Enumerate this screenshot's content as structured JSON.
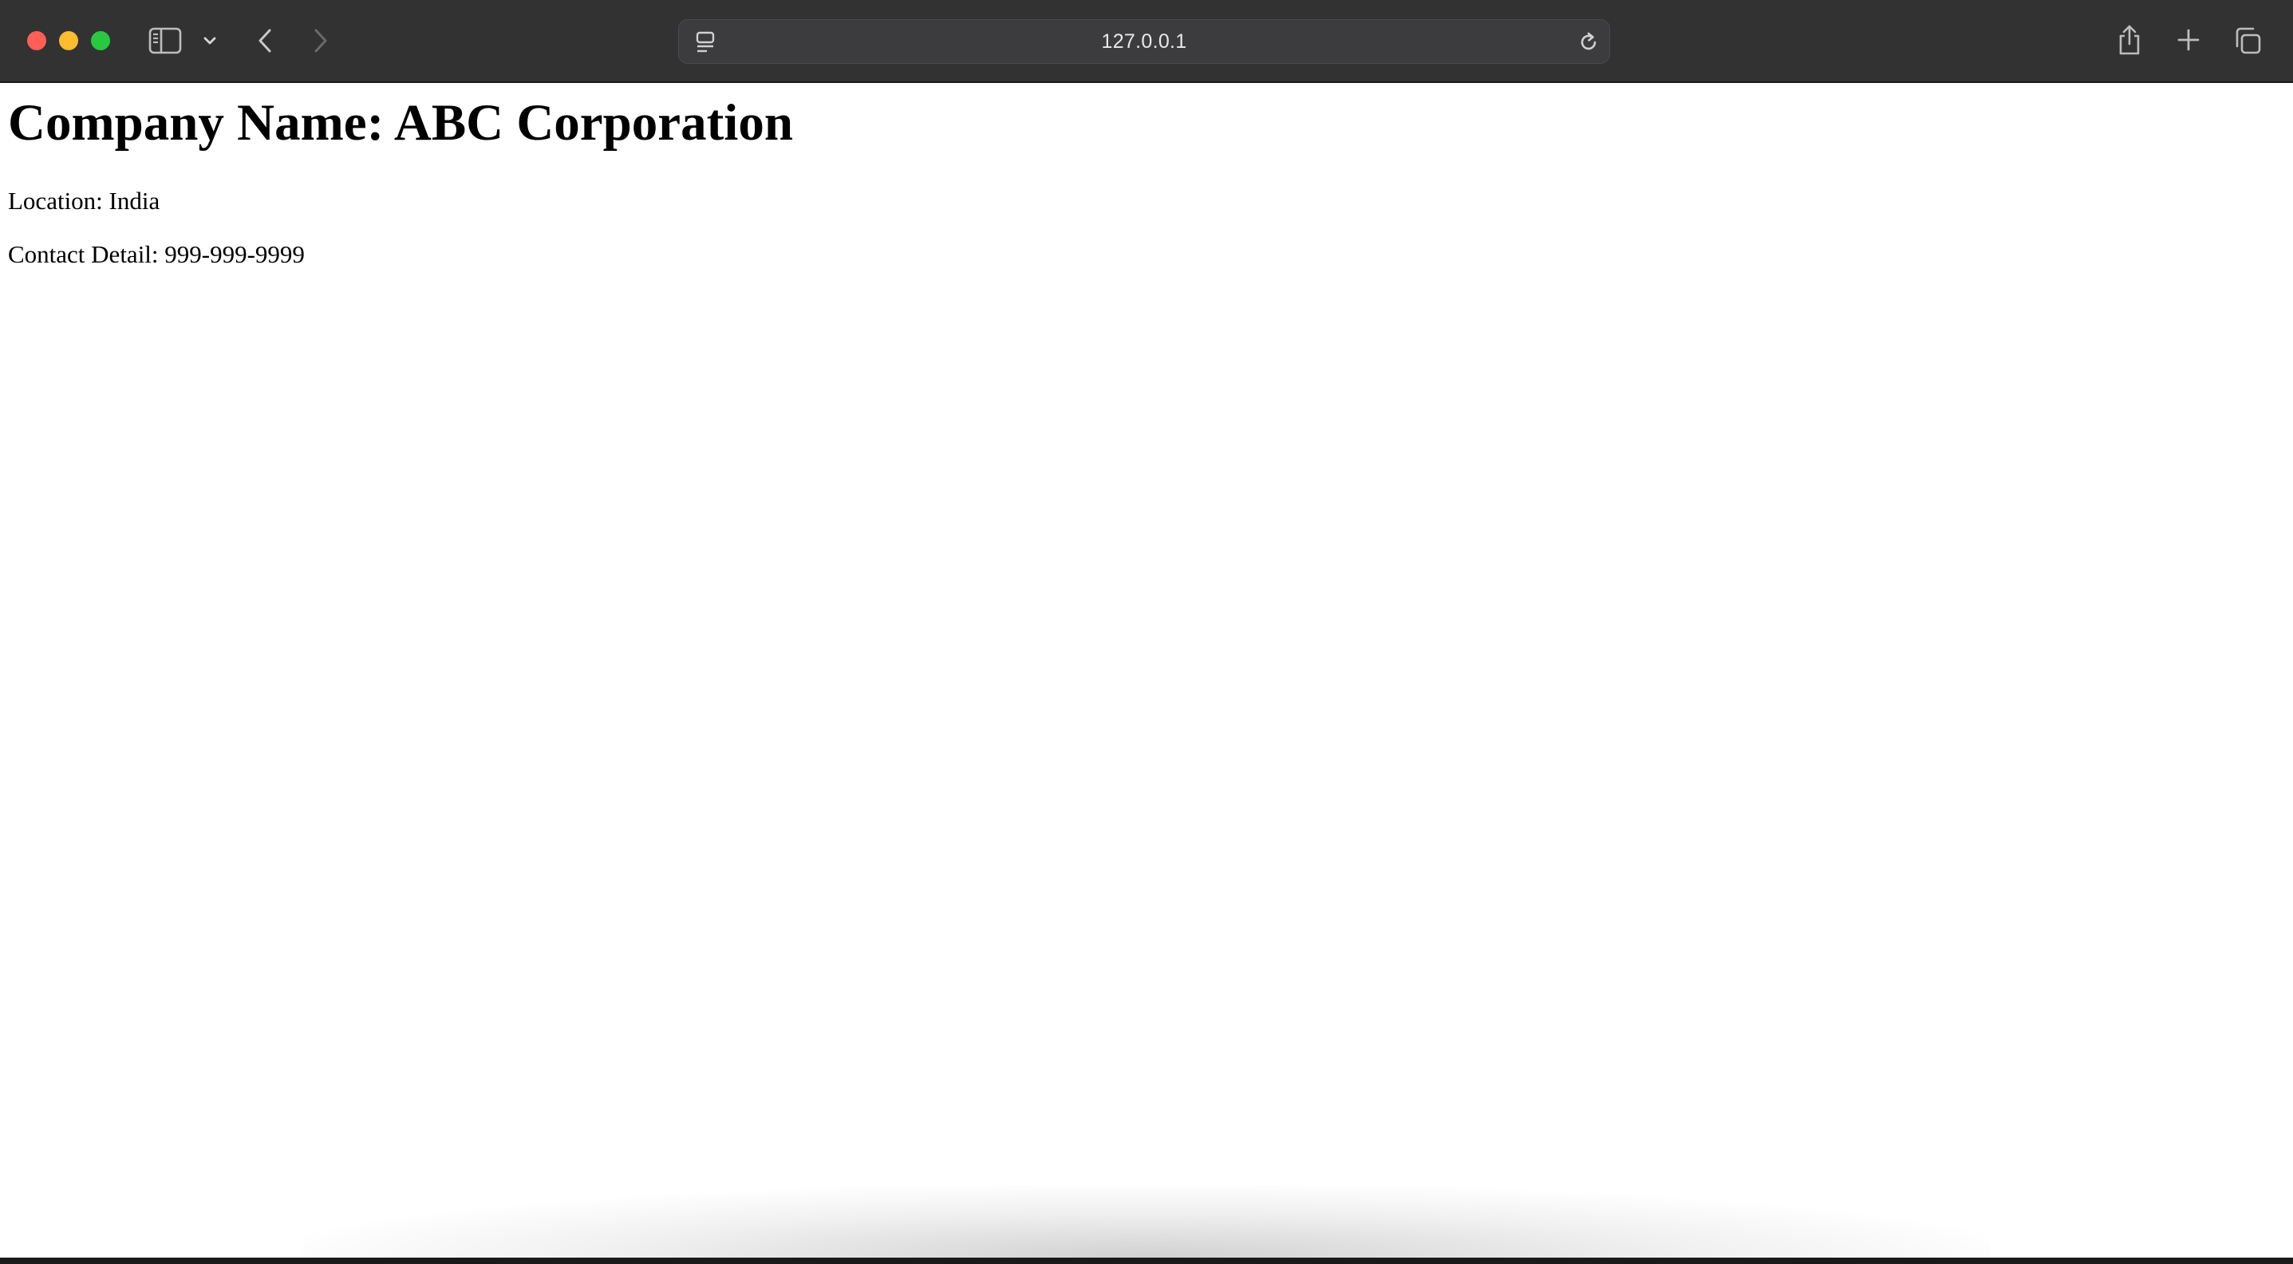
{
  "browser": {
    "url": "127.0.0.1",
    "icons": {
      "sidebar": "sidebar-icon",
      "sidebar_menu": "chevron-down-icon",
      "back": "chevron-left-icon",
      "forward": "chevron-right-icon",
      "page_menu": "page-menu-icon",
      "reload": "reload-icon",
      "share": "share-icon",
      "new_tab": "plus-icon",
      "tab_overview": "tab-overview-icon"
    },
    "colors": {
      "toolbar": "#323233",
      "address_bar": "#3c3c3e",
      "close": "#ff5f57",
      "minimize": "#febc2e",
      "zoom": "#28c840"
    }
  },
  "page": {
    "title": "Company Name: ABC Corporation",
    "location": "Location: India",
    "contact": "Contact Detail: 999-999-9999"
  }
}
